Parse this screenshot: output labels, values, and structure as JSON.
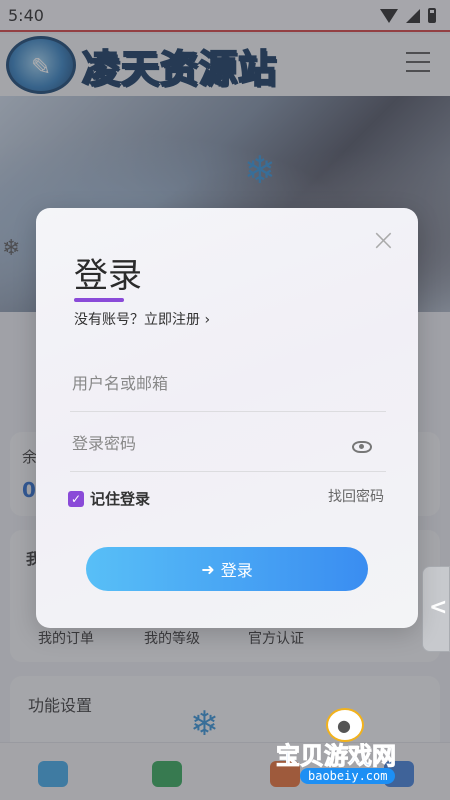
{
  "status_bar": {
    "time": "5:40"
  },
  "header": {
    "site_title": "凌天资源站"
  },
  "background": {
    "my_orders": "我的订单",
    "my_level": "我的等级",
    "official_cert": "官方认证",
    "feature_settings": "功能设置",
    "balance_label": "余",
    "balance_value": "0",
    "section_initial": "我"
  },
  "modal": {
    "title": "登录",
    "register_prompt": "没有账号？立即注册",
    "username_placeholder": "用户名或邮箱",
    "password_placeholder": "登录密码",
    "remember_label": "记住登录",
    "forgot_password": "找回密码",
    "login_button": "登录",
    "close_symbol": "×",
    "chevron_symbol": "›"
  },
  "side_tab": {
    "symbol": "<"
  },
  "watermark": {
    "text": "宝贝游戏网",
    "url": "baobeiy.com"
  },
  "icons": {
    "wifi": "wifi-icon",
    "signal": "signal-icon",
    "battery": "battery-icon",
    "menu": "menu-icon",
    "close": "close-icon",
    "eye": "eye-icon",
    "login": "login-arrow-icon",
    "check": "checkbox-checked-icon",
    "home": "home-icon",
    "wallet": "wallet-icon",
    "user": "user-icon"
  },
  "colors": {
    "accent_purple": "#8a4ad8",
    "button_gradient_start": "#58bff7",
    "button_gradient_end": "#3a8df1",
    "status_line": "#d23b3b"
  }
}
